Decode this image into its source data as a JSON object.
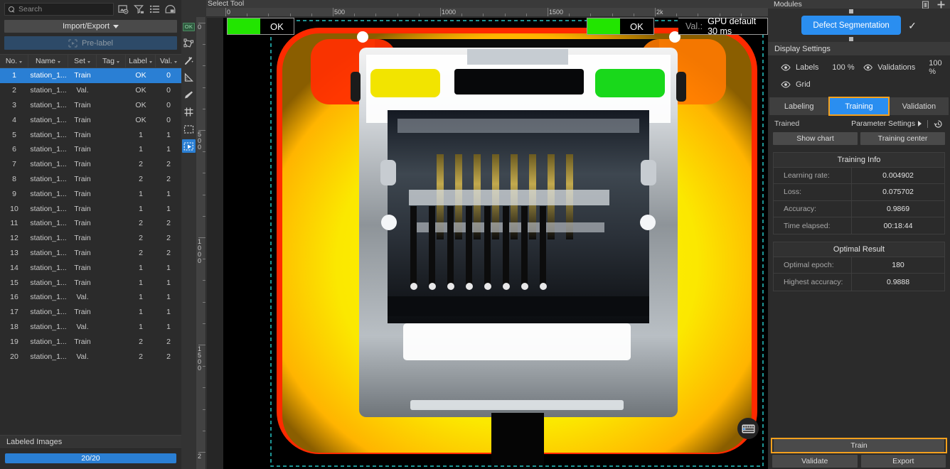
{
  "left_panel": {
    "search": {
      "placeholder": "Search",
      "value": ""
    },
    "toolbar_icons": [
      "image-search-icon",
      "filter-icon",
      "list-view-icon",
      "layout-icon"
    ],
    "import_export_label": "Import/Export",
    "prelabel_label": "Pre-label",
    "columns": [
      "No.",
      "Name",
      "Set",
      "Tag",
      "Label",
      "Val."
    ],
    "rows": [
      {
        "no": "1",
        "name": "station_1...",
        "set": "Train",
        "tag": "",
        "label": "OK",
        "val": "0"
      },
      {
        "no": "2",
        "name": "station_1...",
        "set": "Val.",
        "tag": "",
        "label": "OK",
        "val": "0"
      },
      {
        "no": "3",
        "name": "station_1...",
        "set": "Train",
        "tag": "",
        "label": "OK",
        "val": "0"
      },
      {
        "no": "4",
        "name": "station_1...",
        "set": "Train",
        "tag": "",
        "label": "OK",
        "val": "0"
      },
      {
        "no": "5",
        "name": "station_1...",
        "set": "Train",
        "tag": "",
        "label": "1",
        "val": "1"
      },
      {
        "no": "6",
        "name": "station_1...",
        "set": "Train",
        "tag": "",
        "label": "1",
        "val": "1"
      },
      {
        "no": "7",
        "name": "station_1...",
        "set": "Train",
        "tag": "",
        "label": "2",
        "val": "2"
      },
      {
        "no": "8",
        "name": "station_1...",
        "set": "Train",
        "tag": "",
        "label": "2",
        "val": "2"
      },
      {
        "no": "9",
        "name": "station_1...",
        "set": "Train",
        "tag": "",
        "label": "1",
        "val": "1"
      },
      {
        "no": "10",
        "name": "station_1...",
        "set": "Train",
        "tag": "",
        "label": "1",
        "val": "1"
      },
      {
        "no": "11",
        "name": "station_1...",
        "set": "Train",
        "tag": "",
        "label": "2",
        "val": "2"
      },
      {
        "no": "12",
        "name": "station_1...",
        "set": "Train",
        "tag": "",
        "label": "2",
        "val": "2"
      },
      {
        "no": "13",
        "name": "station_1...",
        "set": "Train",
        "tag": "",
        "label": "2",
        "val": "2"
      },
      {
        "no": "14",
        "name": "station_1...",
        "set": "Train",
        "tag": "",
        "label": "1",
        "val": "1"
      },
      {
        "no": "15",
        "name": "station_1...",
        "set": "Train",
        "tag": "",
        "label": "1",
        "val": "1"
      },
      {
        "no": "16",
        "name": "station_1...",
        "set": "Val.",
        "tag": "",
        "label": "1",
        "val": "1"
      },
      {
        "no": "17",
        "name": "station_1...",
        "set": "Train",
        "tag": "",
        "label": "1",
        "val": "1"
      },
      {
        "no": "18",
        "name": "station_1...",
        "set": "Val.",
        "tag": "",
        "label": "1",
        "val": "1"
      },
      {
        "no": "19",
        "name": "station_1...",
        "set": "Train",
        "tag": "",
        "label": "2",
        "val": "2"
      },
      {
        "no": "20",
        "name": "station_1...",
        "set": "Val.",
        "tag": "",
        "label": "2",
        "val": "2"
      }
    ],
    "selected_row_index": 0,
    "labeled_images_label": "Labeled Images",
    "progress_text": "20/20"
  },
  "canvas": {
    "select_tool_label": "Select Tool",
    "ruler_h_labels": [
      "0",
      "500",
      "1000",
      "1500",
      "2k"
    ],
    "ruler_v_labels": [
      "0",
      "500",
      "1000",
      "1500",
      "2"
    ],
    "badge_left": {
      "status": "OK"
    },
    "badge_right": {
      "status": "OK"
    },
    "val_badge": {
      "key": "Val.:",
      "value": "GPU default 30 ms"
    },
    "vertical_tools": [
      "ok-label-tool-icon",
      "polygon-tool-icon",
      "magic-wand-tool-icon",
      "shape-tool-icon",
      "eraser-tool-icon",
      "grid-tool-icon",
      "marquee-select-tool-icon",
      "move-select-tool-icon"
    ],
    "active_tool_index": 7,
    "keyboard_shortcut_icon": "keyboard-icon"
  },
  "right_panel": {
    "modules_title": "Modules",
    "modules_header_icons": [
      "delete-icon",
      "add-icon"
    ],
    "module_button_label": "Defect Segmentation",
    "module_check": "✓",
    "display_settings_title": "Display Settings",
    "display": {
      "labels_label": "Labels",
      "labels_pct": "100 %",
      "validations_label": "Validations",
      "validations_pct": "100 %",
      "grid_label": "Grid"
    },
    "tabs": [
      {
        "label": "Labeling",
        "active": false
      },
      {
        "label": "Training",
        "active": true
      },
      {
        "label": "Validation",
        "active": false
      }
    ],
    "trained_label": "Trained",
    "parameter_settings_label": "Parameter Settings",
    "history_icon": "history-icon",
    "show_chart_label": "Show chart",
    "training_center_label": "Training center",
    "training_info": {
      "title": "Training Info",
      "rows": [
        {
          "key": "Learning rate:",
          "value": "0.004902"
        },
        {
          "key": "Loss:",
          "value": "0.075702"
        },
        {
          "key": "Accuracy:",
          "value": "0.9869"
        },
        {
          "key": "Time elapsed:",
          "value": "00:18:44"
        }
      ]
    },
    "optimal_result": {
      "title": "Optimal Result",
      "rows": [
        {
          "key": "Optimal epoch:",
          "value": "180"
        },
        {
          "key": "Highest accuracy:",
          "value": "0.9888"
        }
      ]
    },
    "train_label": "Train",
    "validate_label": "Validate",
    "export_label": "Export"
  },
  "colors": {
    "accent_blue": "#2a8ef0",
    "selection_blue": "#2a7fd4",
    "highlight_orange": "#f5a11e",
    "ok_green": "#22e500"
  }
}
